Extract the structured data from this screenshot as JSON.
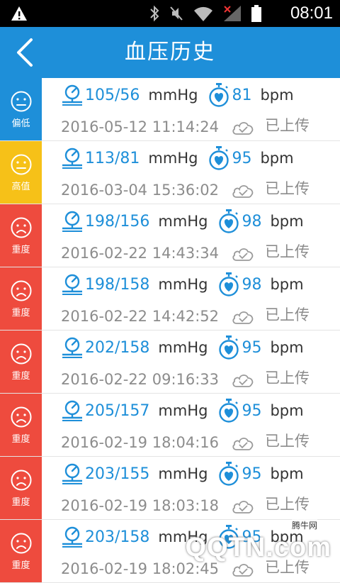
{
  "status_bar": {
    "time": "08:01"
  },
  "app_bar": {
    "title": "血压历史"
  },
  "colors": {
    "accent": "#1e8fd9",
    "low": "#1e8fd9",
    "high": "#f6c118",
    "severe": "#ee4b3e"
  },
  "records": [
    {
      "level": "low",
      "level_label": "偏低",
      "pressure": "105/56",
      "pressure_unit": "mmHg",
      "heart_rate": "81",
      "heart_rate_unit": "bpm",
      "datetime": "2016-05-12 11:14:24",
      "upload_status": "已上传"
    },
    {
      "level": "high",
      "level_label": "高值",
      "pressure": "113/81",
      "pressure_unit": "mmHg",
      "heart_rate": "95",
      "heart_rate_unit": "bpm",
      "datetime": "2016-03-04 15:36:02",
      "upload_status": "已上传"
    },
    {
      "level": "severe",
      "level_label": "重度",
      "pressure": "198/156",
      "pressure_unit": "mmHg",
      "heart_rate": "98",
      "heart_rate_unit": "bpm",
      "datetime": "2016-02-22 14:43:34",
      "upload_status": "已上传"
    },
    {
      "level": "severe",
      "level_label": "重度",
      "pressure": "198/158",
      "pressure_unit": "mmHg",
      "heart_rate": "98",
      "heart_rate_unit": "bpm",
      "datetime": "2016-02-22 14:42:52",
      "upload_status": "已上传"
    },
    {
      "level": "severe",
      "level_label": "重度",
      "pressure": "202/158",
      "pressure_unit": "mmHg",
      "heart_rate": "95",
      "heart_rate_unit": "bpm",
      "datetime": "2016-02-22 09:16:33",
      "upload_status": "已上传"
    },
    {
      "level": "severe",
      "level_label": "重度",
      "pressure": "205/157",
      "pressure_unit": "mmHg",
      "heart_rate": "95",
      "heart_rate_unit": "bpm",
      "datetime": "2016-02-19 18:04:16",
      "upload_status": "已上传"
    },
    {
      "level": "severe",
      "level_label": "重度",
      "pressure": "203/155",
      "pressure_unit": "mmHg",
      "heart_rate": "95",
      "heart_rate_unit": "bpm",
      "datetime": "2016-02-19 18:03:18",
      "upload_status": "已上传"
    },
    {
      "level": "severe",
      "level_label": "重度",
      "pressure": "203/158",
      "pressure_unit": "mmHg",
      "heart_rate": "95",
      "heart_rate_unit": "bpm",
      "datetime": "2016-02-19 18:02:45",
      "upload_status": "已上传"
    }
  ],
  "watermark": {
    "small": "腾牛网",
    "big": "QQTN.com"
  }
}
